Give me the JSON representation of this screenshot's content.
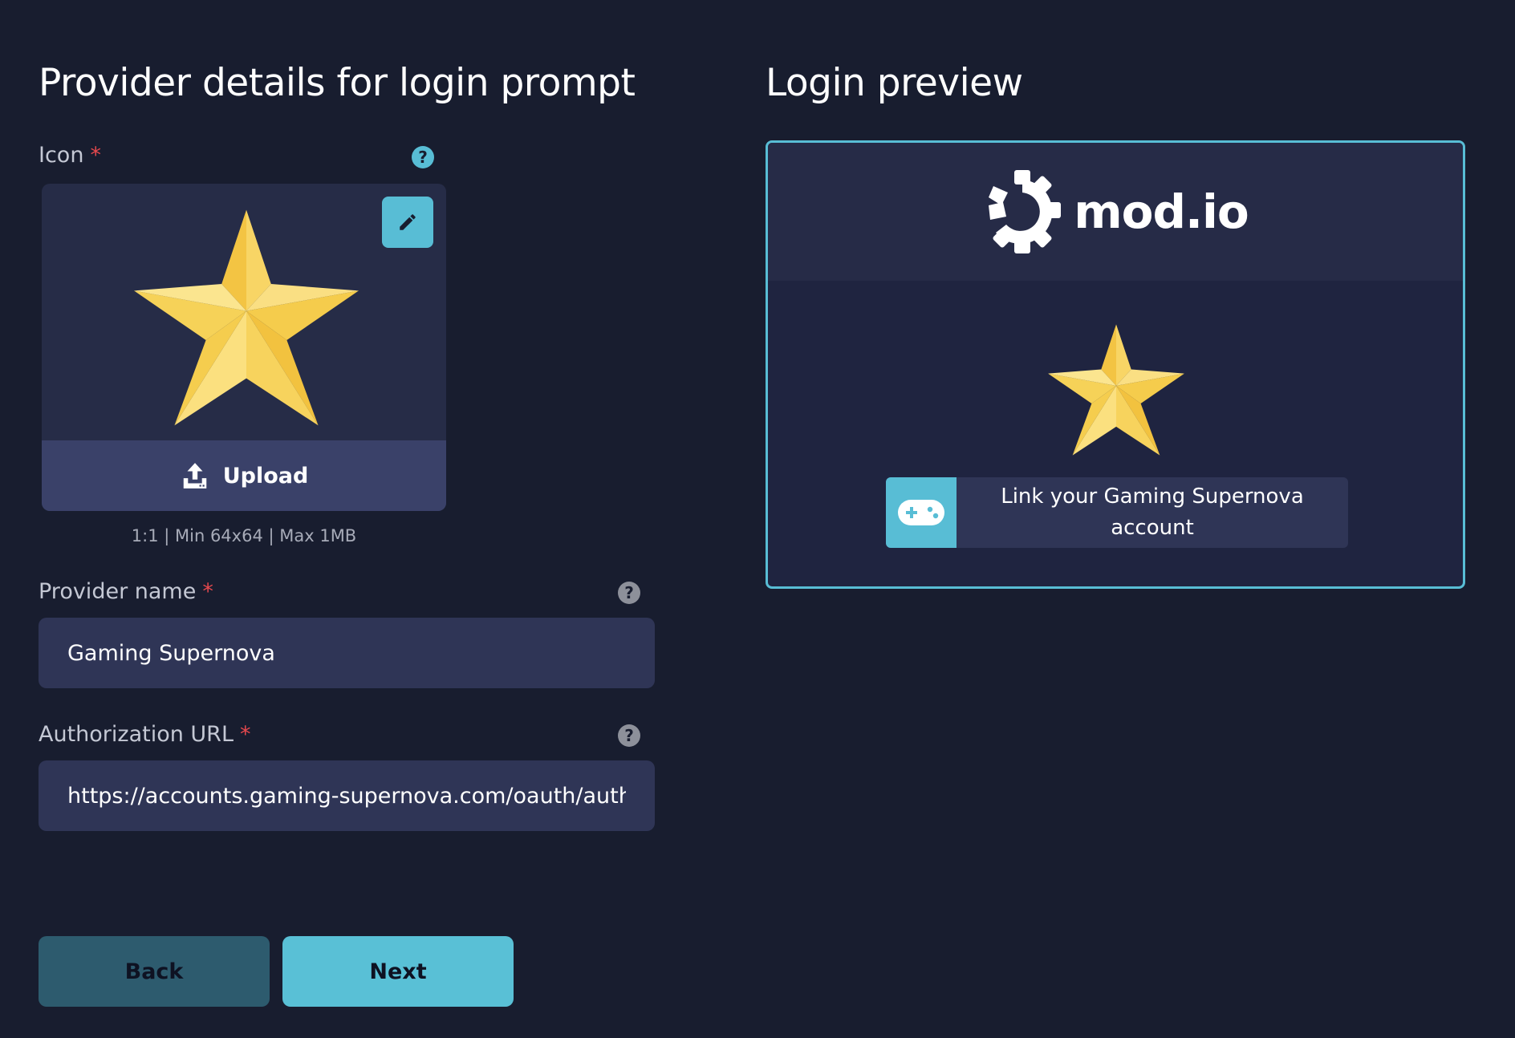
{
  "form": {
    "title": "Provider details for login prompt",
    "icon": {
      "label": "Icon",
      "required_marker": "*",
      "help_icon": "question-circle-icon",
      "edit_icon": "pencil-icon",
      "upload_icon": "upload-icon",
      "upload_label": "Upload",
      "hint": "1:1 | Min 64x64 | Max 1MB"
    },
    "provider_name": {
      "label": "Provider name",
      "required_marker": "*",
      "help_icon": "question-circle-icon",
      "value": "Gaming Supernova"
    },
    "authorization_url": {
      "label": "Authorization URL",
      "required_marker": "*",
      "help_icon": "question-circle-icon",
      "value": "https://accounts.gaming-supernova.com/oauth/authorize"
    },
    "buttons": {
      "back": "Back",
      "next": "Next"
    }
  },
  "preview": {
    "title": "Login preview",
    "brand": {
      "logo_icon": "modio-cog-icon",
      "text": "mod.io"
    },
    "provider_icon": "star-icon",
    "link_button": {
      "icon": "gamepad-icon",
      "label": "Link your Gaming Supernova account"
    }
  },
  "colors": {
    "background": "#181d2f",
    "card": "#262c47",
    "input": "#2f3556",
    "accent": "#58bdd5",
    "back_button": "#2d5b6e",
    "required": "#e5484d",
    "star": "#f5cd48"
  }
}
